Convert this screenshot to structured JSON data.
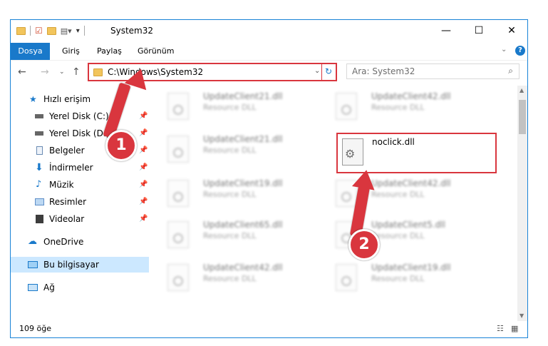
{
  "window": {
    "title": "System32",
    "controls": {
      "minimize": "—",
      "maximize": "☐",
      "close": "✕"
    }
  },
  "ribbon": {
    "tabs": [
      "Dosya",
      "Giriş",
      "Paylaş",
      "Görünüm"
    ]
  },
  "address": {
    "path": "C:\\Windows\\System32",
    "search_placeholder": "Ara: System32"
  },
  "sidebar": {
    "quick_access": "Hızlı erişim",
    "items": [
      {
        "label": "Yerel Disk (C:)",
        "icon": "drive-icon"
      },
      {
        "label": "Yerel Disk (D:)",
        "icon": "drive-icon"
      },
      {
        "label": "Belgeler",
        "icon": "documents-icon"
      },
      {
        "label": "İndirmeler",
        "icon": "download-icon"
      },
      {
        "label": "Müzik",
        "icon": "music-icon"
      },
      {
        "label": "Resimler",
        "icon": "pictures-icon"
      },
      {
        "label": "Videolar",
        "icon": "video-icon"
      }
    ],
    "onedrive": "OneDrive",
    "this_pc": "Bu bilgisayar",
    "network": "Ağ"
  },
  "files": {
    "left": [
      {
        "name": "UpdateClient21.dll",
        "type": "Resource DLL"
      },
      {
        "name": "UpdateClient21.dll",
        "type": "Resource DLL"
      },
      {
        "name": "UpdateClient19.dll",
        "type": "Resource DLL"
      },
      {
        "name": "UpdateClient65.dll",
        "type": "Resource DLL"
      },
      {
        "name": "UpdateClient42.dll",
        "type": "Resource DLL"
      }
    ],
    "right": [
      {
        "name": "UpdateClient42.dll",
        "type": "Resource DLL"
      },
      {
        "name": "UpdateClient42.dll",
        "type": "Resource DLL"
      },
      {
        "name": "UpdateClient5.dll",
        "type": "Resource DLL"
      },
      {
        "name": "UpdateClient19.dll",
        "type": "Resource DLL"
      }
    ],
    "highlighted": {
      "name": "noclick.dll"
    }
  },
  "status": {
    "count": "109 öğe"
  },
  "annotations": {
    "step1": "1",
    "step2": "2"
  },
  "colors": {
    "accent": "#1979ca",
    "highlight": "#d9363e",
    "selected": "#cce8ff"
  }
}
